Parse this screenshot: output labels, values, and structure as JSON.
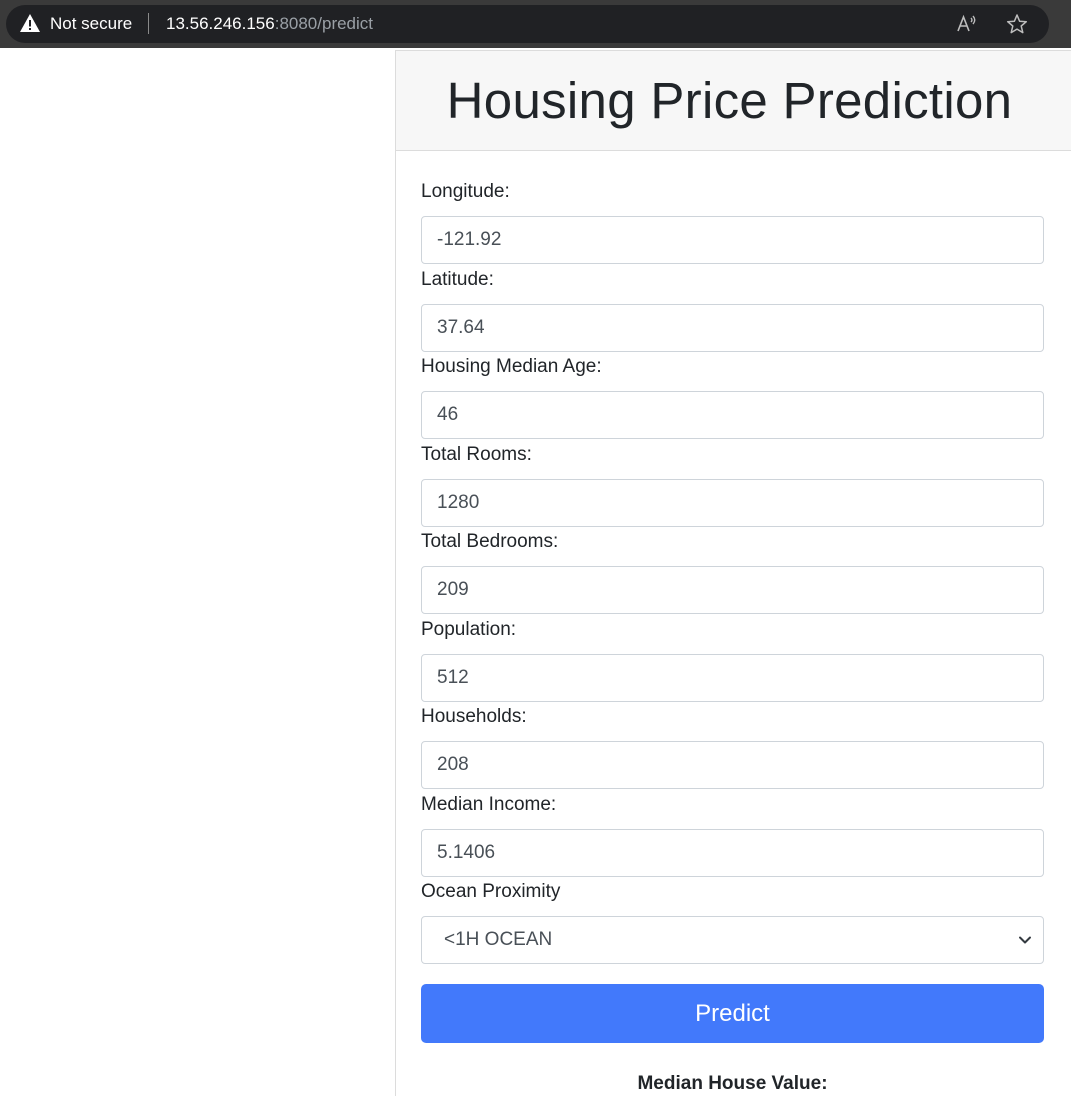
{
  "browser": {
    "security_label": "Not secure",
    "url_host": "13.56.246.156",
    "url_rest": ":8080/predict"
  },
  "page": {
    "title": "Housing Price Prediction"
  },
  "form": {
    "fields": [
      {
        "label": "Longitude:",
        "value": "-121.92"
      },
      {
        "label": "Latitude:",
        "value": "37.64"
      },
      {
        "label": "Housing Median Age:",
        "value": "46"
      },
      {
        "label": "Total Rooms:",
        "value": "1280"
      },
      {
        "label": "Total Bedrooms:",
        "value": "209"
      },
      {
        "label": "Population:",
        "value": "512"
      },
      {
        "label": "Households:",
        "value": "208"
      },
      {
        "label": "Median Income:",
        "value": "5.1406"
      }
    ],
    "ocean_proximity": {
      "label": "Ocean Proximity",
      "selected": "<1H OCEAN"
    },
    "submit_label": "Predict"
  },
  "result": {
    "label": "Median House Value:"
  },
  "colors": {
    "accent": "#4279fb",
    "header_bg": "#f7f7f7",
    "browser_bar": "#3a3a3a"
  },
  "icons": [
    "warning-icon",
    "read-aloud-icon",
    "favorite-star-icon",
    "chevron-down-icon"
  ]
}
